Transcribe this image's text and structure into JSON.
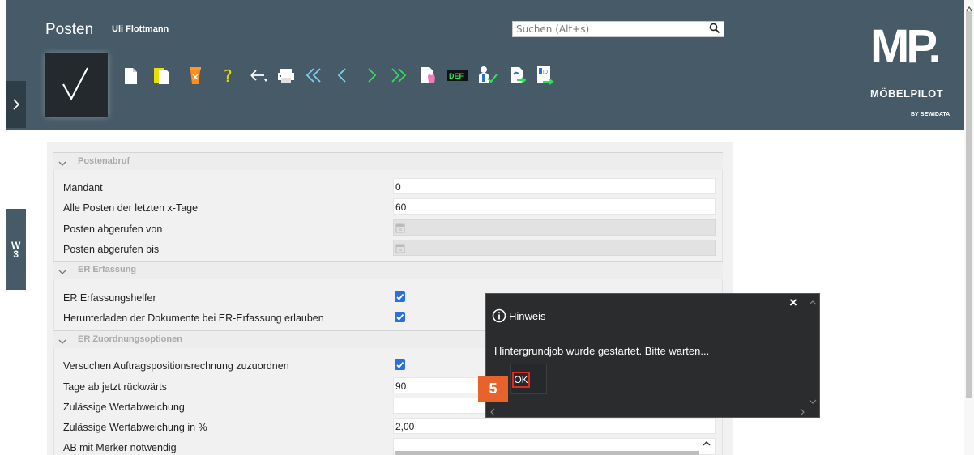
{
  "header": {
    "title": "Posten",
    "user": "Uli Flottmann",
    "search_placeholder": "Suchen (Alt+s)",
    "logo": {
      "letters": "MP.",
      "brand": "MÖBELPILOT",
      "byline": "BY BEWIDATA"
    },
    "toolbar_icons": [
      "new-document-icon",
      "copy-document-icon",
      "delete-icon",
      "help-icon",
      "back-dropdown-icon",
      "print-icon",
      "first-record-icon",
      "previous-record-icon",
      "next-record-icon",
      "last-record-icon",
      "document-hand-icon",
      "def-icon",
      "user-check-icon",
      "export-icon",
      "id-card-icon"
    ],
    "toolbar_def_label": "DEF"
  },
  "sidebar": {
    "tab_label_1": "W",
    "tab_label_2": "3"
  },
  "sections": {
    "postenabruf": {
      "title": "Postenabruf",
      "rows": [
        {
          "label": "Mandant",
          "value": "0"
        },
        {
          "label": "Alle Posten der letzten x-Tage",
          "value": "60"
        },
        {
          "label": "Posten abgerufen von",
          "value": ""
        },
        {
          "label": "Posten abgerufen bis",
          "value": ""
        }
      ]
    },
    "er_erfassung": {
      "title": "ER Erfassung",
      "rows": [
        {
          "label": "ER Erfassungshelfer",
          "checked": true
        },
        {
          "label": "Herunterladen der Dokumente bei ER-Erfassung erlauben",
          "checked": true
        }
      ]
    },
    "er_zuordnung": {
      "title": "ER Zuordnungsoptionen",
      "rows": [
        {
          "label": "Versuchen Auftragspositionsrechnung zuzuordnen",
          "checked": true
        },
        {
          "label": "Tage ab jetzt rückwärts",
          "value": "90"
        },
        {
          "label": "Zulässige Wertabweichung",
          "value": ""
        },
        {
          "label": "Zulässige Wertabweichung in %",
          "value": "2,00"
        },
        {
          "label": "AB mit Merker notwendig",
          "value": ""
        }
      ]
    }
  },
  "dialog": {
    "title": "Hinweis",
    "message": "Hintergrundjob wurde gestartet. Bitte warten...",
    "ok_label": "OK",
    "close_label": "×"
  },
  "step_badge": "5",
  "colors": {
    "header": "#465a67",
    "accent": "#e8632b",
    "checkbox": "#2a6fdb",
    "dialog_bg": "#2a2c2e"
  }
}
